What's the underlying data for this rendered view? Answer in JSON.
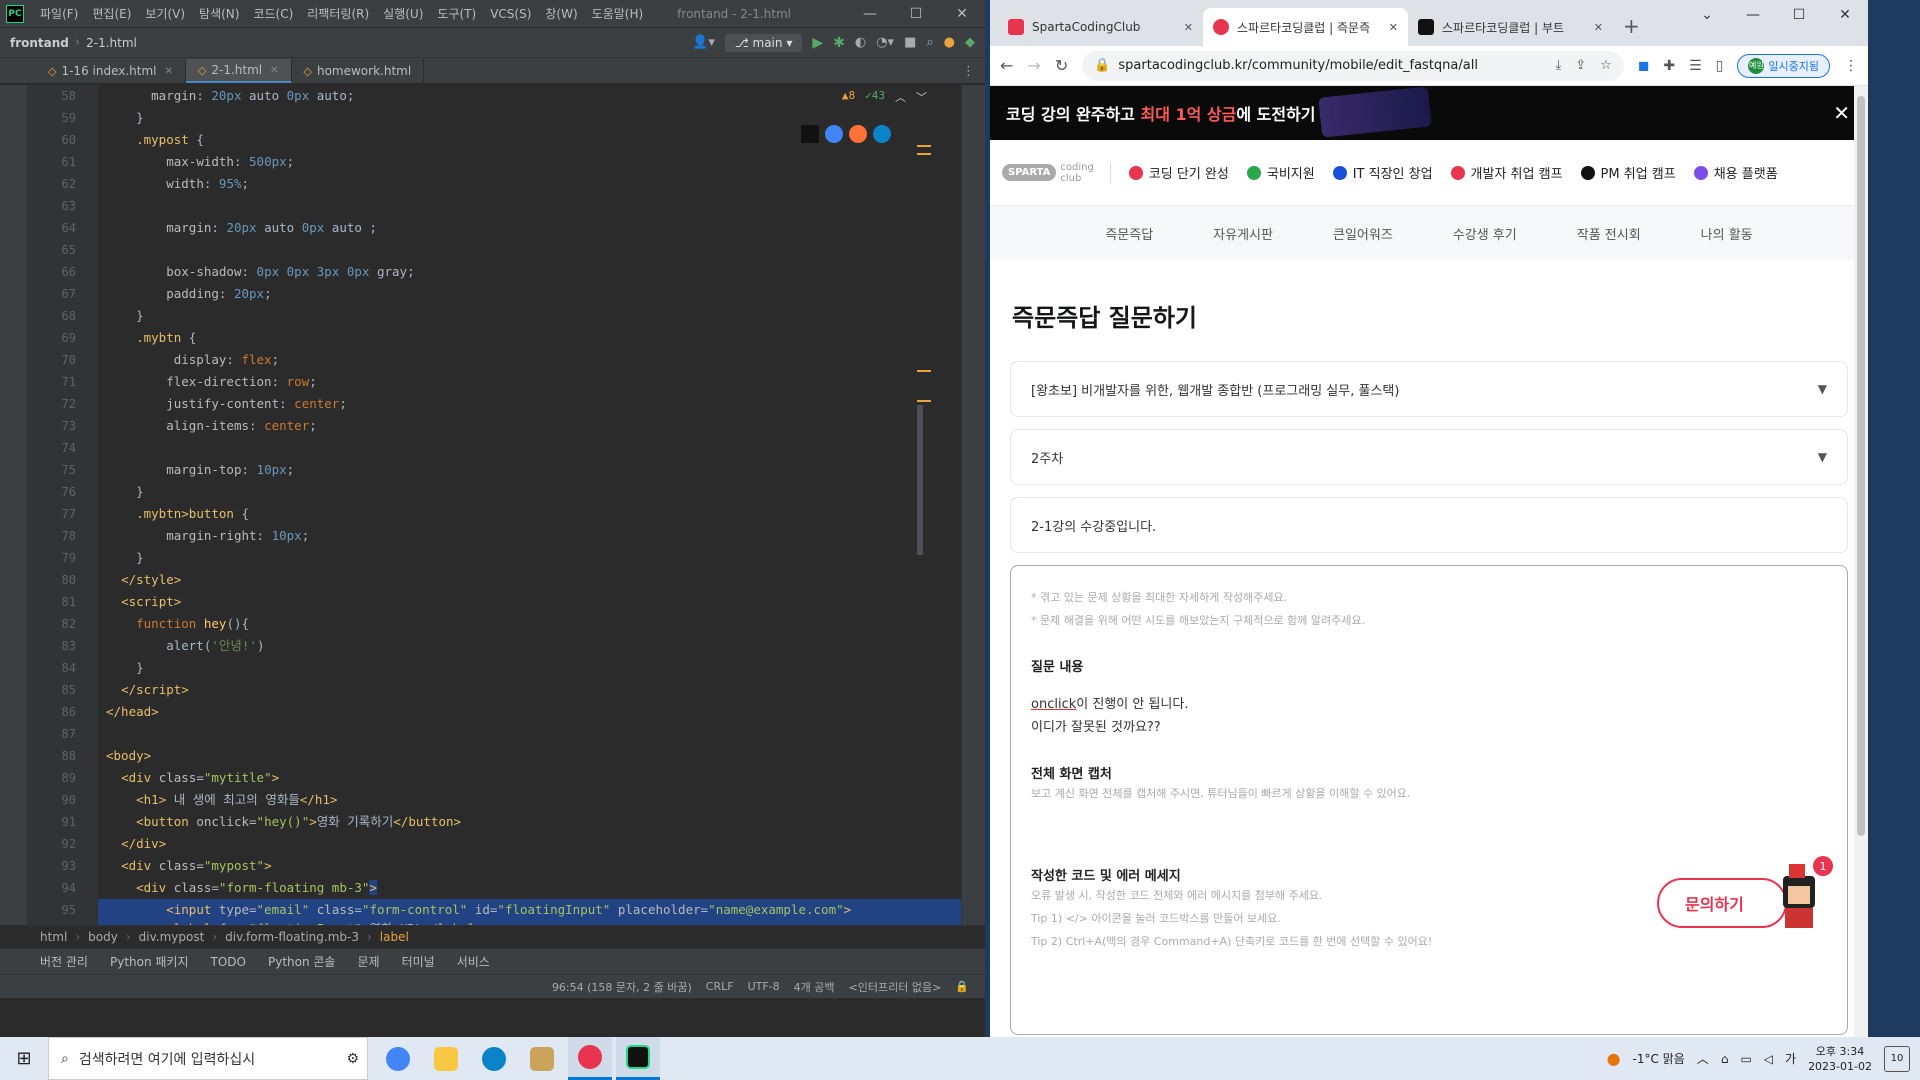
{
  "ide": {
    "menu": [
      "파일(F)",
      "편집(E)",
      "보기(V)",
      "탐색(N)",
      "코드(C)",
      "리팩터링(R)",
      "실행(U)",
      "도구(T)",
      "VCS(S)",
      "창(W)",
      "도움말(H)"
    ],
    "title": "frontand - 2-1.html",
    "project": "frontand",
    "file": "2-1.html",
    "branch": "main",
    "tabs": [
      "1-16 index.html",
      "2-1.html",
      "homework.html"
    ],
    "warnings": "▲8",
    "ok": "✓43",
    "gutter_start": 58,
    "breadcrumb": [
      "html",
      "body",
      "div.mypost",
      "div.form-floating.mb-3",
      "label"
    ],
    "tool_tabs": [
      "버전 관리",
      "Python 패키지",
      "TODO",
      "Python 콘솔",
      "문제",
      "터미널",
      "서비스"
    ],
    "status": [
      "96:54 (158 문자, 2 줄 바꿈)",
      "CRLF",
      "UTF-8",
      "4개 공백",
      "<인터프리터 없음>"
    ],
    "colors": {
      "bg": "#2b2b2b",
      "sel": "#214283",
      "accent": "#4a88c7"
    }
  },
  "browser": {
    "tabs": [
      {
        "title": "SpartaCodingClub",
        "color": "#e8344e"
      },
      {
        "title": "스파르타코딩클럽 | 즉문즉",
        "color": "#e8344e"
      },
      {
        "title": "스파르타코딩클럽 | 부트",
        "color": "#111111"
      }
    ],
    "url": "spartacodingclub.kr/community/mobile/edit_fastqna/all",
    "profile": "일시중지됨",
    "profile_av": "예원",
    "banner": {
      "pre": "코딩 강의 완주하고 ",
      "hl": "최대 1억 상금",
      "post": "에 도전하기"
    },
    "logo": "SPARTA",
    "logo_sub": [
      "coding",
      "club"
    ],
    "nav": [
      {
        "label": "코딩 단기 완성",
        "color": "#e8344e"
      },
      {
        "label": "국비지원",
        "color": "#2ba84a"
      },
      {
        "label": "IT 직장인 창업",
        "color": "#1a4fd8"
      },
      {
        "label": "개발자 취업 캠프",
        "color": "#e8344e"
      },
      {
        "label": "PM 취업 캠프",
        "color": "#111111"
      },
      {
        "label": "채용 플랫폼",
        "color": "#7b4fe8"
      }
    ],
    "subnav": [
      "즉문즉답",
      "자유게시판",
      "큰일어워즈",
      "수강생 후기",
      "작품 전시회",
      "나의 활동"
    ],
    "page_title": "즉문즉답 질문하기",
    "course": "[왕초보] 비개발자를 위한, 웹개발 종합반 (프로그래밍 실무, 풀스택)",
    "week": "2주차",
    "lesson": "2-1강의 수강중입니다.",
    "hints": [
      "* 겪고 있는 문제 상황을 최대한 자세하게 작성해주세요.",
      "* 문제 해결을 위해 어떤 시도를 해보았는지 구체적으로 함께 알려주세요."
    ],
    "q_label": "질문 내용",
    "q_line1_u": "onclick",
    "q_line1": "이 진행이 안 됩니다.",
    "q_line2": "이디가 잘못된 것까요??",
    "cap_label": "전체 화면 캡처",
    "cap_hint": "보고 계신 화면 전체를 캡처해 주시면, 튜터님들이 빠르게 상황을 이해할 수 있어요.",
    "code_label": "작성한 코드 및 에러 메세지",
    "code_hints": [
      "오류 발생 시, 작성한 코드 전체와 에러 메시지를 첨부해 주세요.",
      "Tip 1) </> 아이콘을 눌러 코드박스를 만들어 보세요.",
      "Tip 2) Ctrl+A(맥의 경우 Command+A) 단축키로 코드를 한 번에 선택할 수 있어요!"
    ],
    "ask_btn": "문의하기",
    "notif": "1"
  },
  "taskbar": {
    "search": "검색하려면 여기에 입력하십시",
    "weather": "-1°C 맑음",
    "ime": "가",
    "time": "오후 3:34",
    "date": "2023-01-02",
    "notif": "10"
  }
}
